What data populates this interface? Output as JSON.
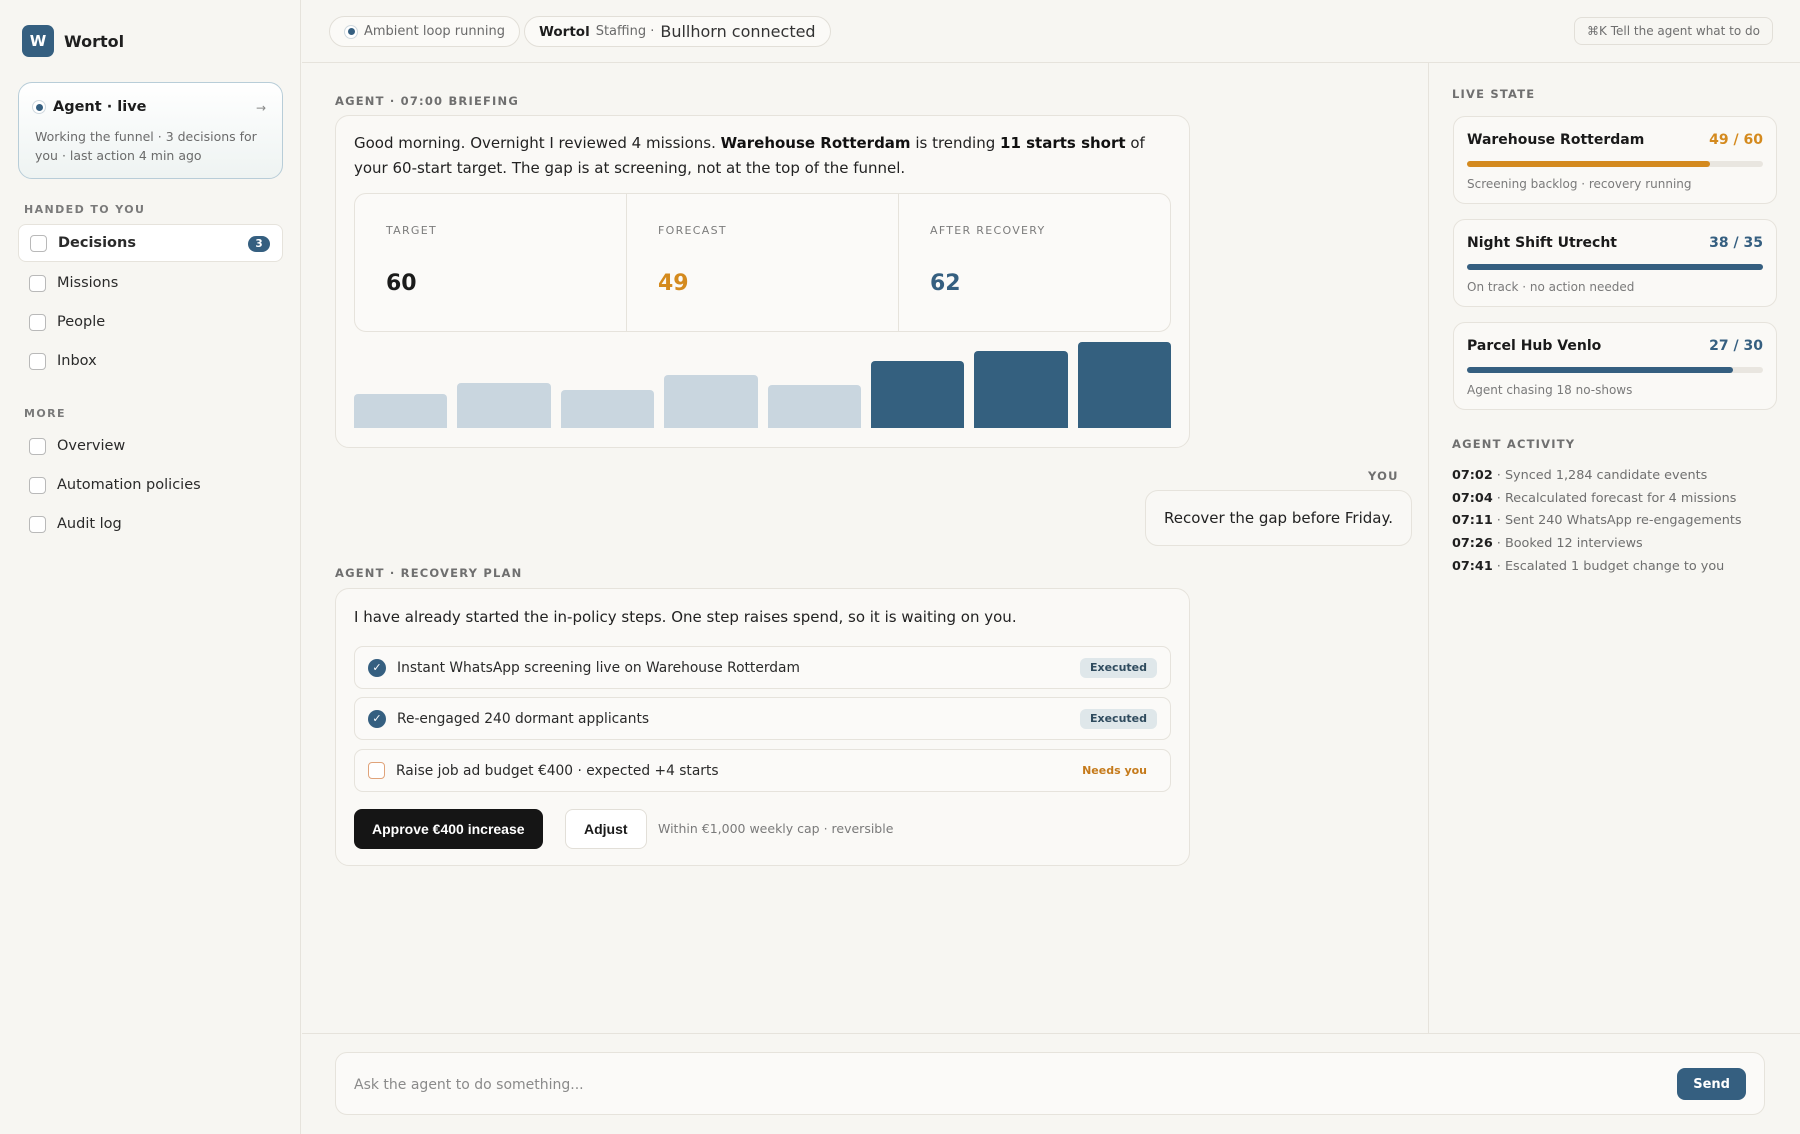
{
  "brand": {
    "logo_letter": "W",
    "name": "Wortol"
  },
  "agent_card": {
    "title": "Agent · live",
    "arrow": "→",
    "description": "Working the funnel · 3 decisions for you · last action 4 min ago"
  },
  "sidebar": {
    "handed_label": "HANDED TO YOU",
    "handed_items": [
      {
        "label": "Decisions",
        "badge": "3"
      },
      {
        "label": "Missions"
      },
      {
        "label": "People"
      },
      {
        "label": "Inbox"
      }
    ],
    "more_label": "MORE",
    "more_items": [
      {
        "label": "Overview"
      },
      {
        "label": "Automation policies"
      },
      {
        "label": "Audit log"
      }
    ]
  },
  "topbar": {
    "ambient": "Ambient loop running",
    "org": "Wortol",
    "context": "Staffing ·",
    "connection": "Bullhorn connected",
    "cmdk": "⌘K Tell the agent what to do"
  },
  "briefing": {
    "label": "AGENT · 07:00 BRIEFING",
    "text_1": "Good morning. Overnight I reviewed 4 missions. ",
    "text_bold_1": "Warehouse Rotterdam",
    "text_2": " is trending ",
    "text_bold_2": "11 starts short",
    "text_3": " of your 60-start target. The gap is at screening, not at the top of the funnel.",
    "stats": [
      {
        "label": "TARGET",
        "value": "60",
        "color": "#1b1b1b"
      },
      {
        "label": "FORECAST",
        "value": "49",
        "color": "#d48a1e"
      },
      {
        "label": "AFTER RECOVERY",
        "value": "62",
        "color": "#355f80"
      }
    ]
  },
  "chart_data": {
    "type": "bar",
    "values": [
      33,
      44,
      37,
      52,
      42,
      65,
      75,
      84
    ],
    "highlight_from_index": 5,
    "colors": {
      "past": "#c9d6df",
      "recovery": "#34607f"
    }
  },
  "you": {
    "label": "YOU",
    "message": "Recover the gap before Friday."
  },
  "plan": {
    "label": "AGENT · RECOVERY PLAN",
    "intro": "I have already started the in-policy steps. One step raises spend, so it is waiting on you.",
    "steps": [
      {
        "text": "Instant WhatsApp screening live on Warehouse Rotterdam",
        "status": "Executed",
        "done": true
      },
      {
        "text": "Re-engaged 240 dormant applicants",
        "status": "Executed",
        "done": true
      },
      {
        "text": "Raise job ad budget €400 · expected +4 starts",
        "status": "Needs you",
        "done": false
      }
    ],
    "approve_label": "Approve €400 increase",
    "adjust_label": "Adjust",
    "cap_note": "Within €1,000 weekly cap · reversible"
  },
  "live_state": {
    "label": "LIVE STATE",
    "missions": [
      {
        "name": "Warehouse Rotterdam",
        "count": "49 / 60",
        "progress": 0.82,
        "color": "#d48a1e",
        "sub": "Screening backlog · recovery running"
      },
      {
        "name": "Night Shift Utrecht",
        "count": "38 / 35",
        "progress": 1.0,
        "color": "#355f80",
        "sub": "On track · no action needed"
      },
      {
        "name": "Parcel Hub Venlo",
        "count": "27 / 30",
        "progress": 0.9,
        "color": "#355f80",
        "sub": "Agent chasing 18 no-shows"
      }
    ]
  },
  "activity": {
    "label": "AGENT ACTIVITY",
    "items": [
      {
        "time": "07:02",
        "text": " · Synced 1,284 candidate events"
      },
      {
        "time": "07:04",
        "text": " · Recalculated forecast for 4 missions"
      },
      {
        "time": "07:11",
        "text": " · Sent 240 WhatsApp re-engagements"
      },
      {
        "time": "07:26",
        "text": " · Booked 12 interviews"
      },
      {
        "time": "07:41",
        "text": " · Escalated 1 budget change to you"
      }
    ]
  },
  "composer": {
    "placeholder": "Ask the agent to do something...",
    "send_label": "Send"
  }
}
